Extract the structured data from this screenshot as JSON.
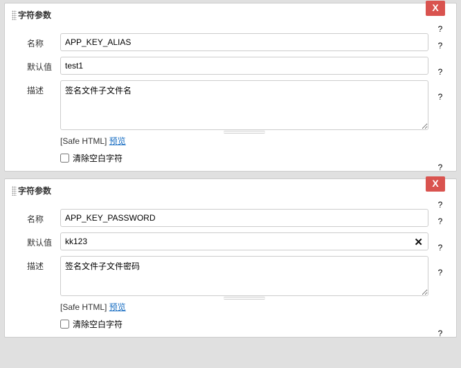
{
  "icons": {
    "close": "X",
    "help": "?",
    "clear": "✕"
  },
  "labels": {
    "section_title": "字符参数",
    "name": "名称",
    "default": "默认值",
    "desc": "描述",
    "safe_html": "[Safe HTML]",
    "preview": "预览",
    "trim": "清除空白字符"
  },
  "params": [
    {
      "name_value": "APP_KEY_ALIAS",
      "default_value": "test1",
      "desc_value": "签名文件子文件名",
      "has_clear": false,
      "trim_checked": false,
      "desc_height": 72
    },
    {
      "name_value": "APP_KEY_PASSWORD",
      "default_value": "kk123",
      "desc_value": "签名文件子文件密码",
      "has_clear": true,
      "trim_checked": false,
      "desc_height": 58
    }
  ]
}
